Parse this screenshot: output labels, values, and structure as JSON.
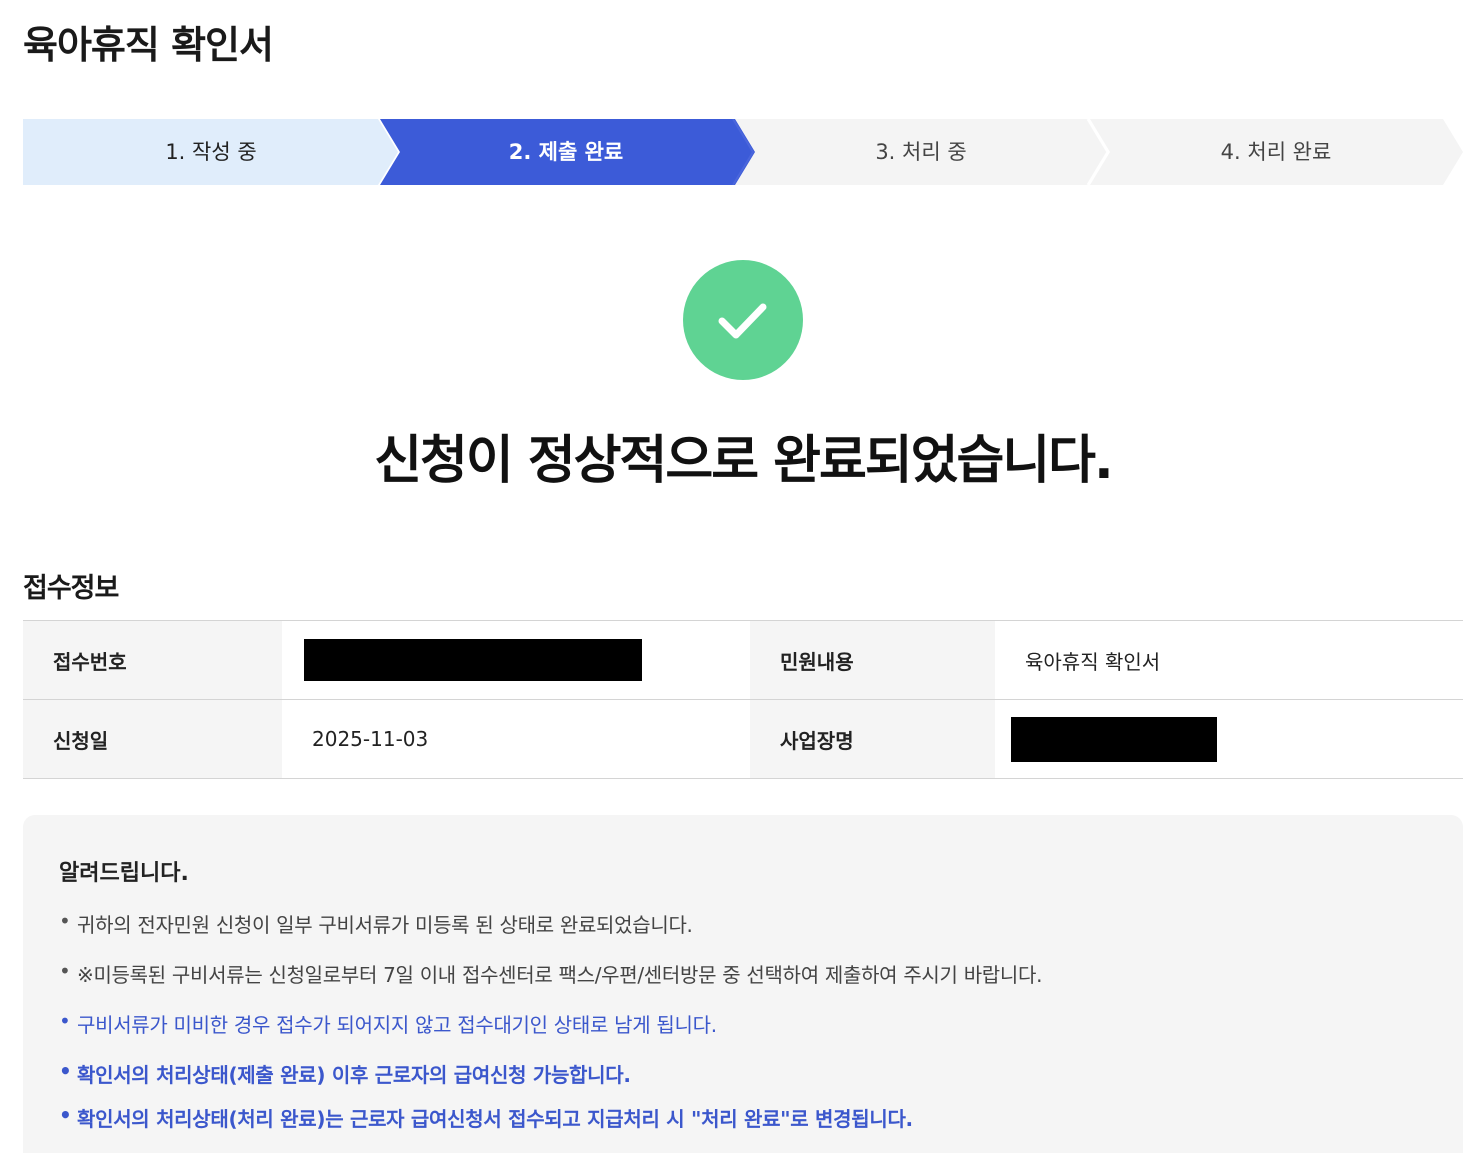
{
  "page": {
    "title": "육아휴직 확인서"
  },
  "steps": [
    {
      "label": "1. 작성 중",
      "state": "done"
    },
    {
      "label": "2. 제출 완료",
      "state": "current"
    },
    {
      "label": "3. 처리 중",
      "state": "pending"
    },
    {
      "label": "4. 처리 완료",
      "state": "pending"
    }
  ],
  "status": {
    "icon": "check-icon",
    "message": "신청이 정상적으로 완료되었습니다."
  },
  "receipt": {
    "section_title": "접수정보",
    "receipt_no_label": "접수번호",
    "receipt_no_value": "",
    "content_label": "민원내용",
    "content_value": "육아휴직 확인서",
    "date_label": "신청일",
    "date_value": "2025-11-03",
    "company_label": "사업장명",
    "company_value": ""
  },
  "notice": {
    "title": "알려드립니다.",
    "items": [
      "귀하의 전자민원 신청이 일부 구비서류가 미등록 된 상태로 완료되었습니다.",
      "※미등록된 구비서류는 신청일로부터 7일 이내 접수센터로 팩스/우편/센터방문 중 선택하여 제출하여 주시기 바랍니다.",
      "구비서류가 미비한 경우 접수가 되어지지 않고 접수대기인 상태로 남게 됩니다.",
      "확인서의 처리상태(제출 완료) 이후 근로자의 급여신청 가능합니다.",
      "확인서의 처리상태(처리 완료)는 근로자 급여신청서 접수되고 지급처리 시 \"처리 완료\"로 변경됩니다."
    ]
  },
  "colors": {
    "step_done": "#e0edfb",
    "step_current": "#3c5bd8",
    "step_pending": "#f4f4f4",
    "success": "#5fd393",
    "notice_link": "#3b57cc"
  }
}
